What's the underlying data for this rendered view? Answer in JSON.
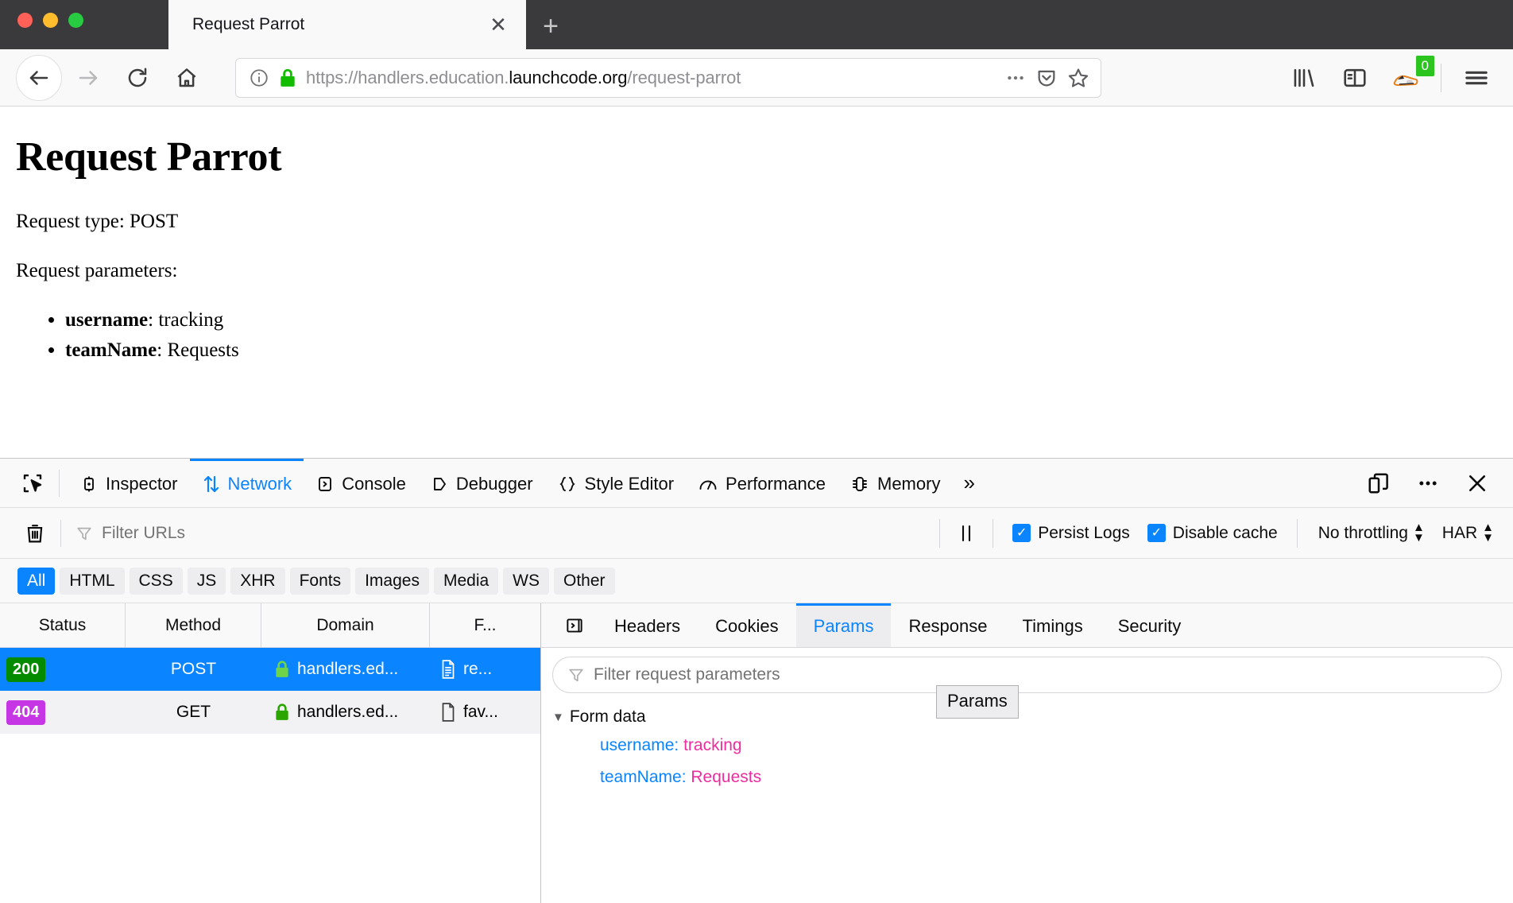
{
  "browser": {
    "tab": {
      "title": "Request Parrot",
      "close_label": "✕"
    },
    "new_tab_label": "+",
    "url": {
      "prefix": "https://handlers.education.",
      "host": "launchcode.org",
      "suffix": "/request-parrot"
    },
    "extension_badge": "0"
  },
  "page": {
    "heading": "Request Parrot",
    "request_type_line": "Request type: POST",
    "parameters_label": "Request parameters:",
    "parameters": [
      {
        "name": "username",
        "sep": ": ",
        "value": "tracking"
      },
      {
        "name": "teamName",
        "sep": ": ",
        "value": "Requests"
      }
    ]
  },
  "devtools": {
    "tabs": [
      {
        "label": "Inspector",
        "icon": "inspector-icon",
        "active": false
      },
      {
        "label": "Network",
        "icon": "network-icon",
        "active": true
      },
      {
        "label": "Console",
        "icon": "console-icon",
        "active": false
      },
      {
        "label": "Debugger",
        "icon": "debugger-icon",
        "active": false
      },
      {
        "label": "Style Editor",
        "icon": "style-editor-icon",
        "active": false
      },
      {
        "label": "Performance",
        "icon": "performance-icon",
        "active": false
      },
      {
        "label": "Memory",
        "icon": "memory-icon",
        "active": false
      }
    ],
    "overflow_label": "»",
    "network": {
      "filter_urls_placeholder": "Filter URLs",
      "persist_logs_label": "Persist Logs",
      "persist_logs_checked": true,
      "disable_cache_label": "Disable cache",
      "disable_cache_checked": true,
      "throttling_label": "No throttling",
      "har_label": "HAR",
      "checkmark": "✓",
      "pills": [
        {
          "label": "All",
          "active": true
        },
        {
          "label": "HTML",
          "active": false
        },
        {
          "label": "CSS",
          "active": false
        },
        {
          "label": "JS",
          "active": false
        },
        {
          "label": "XHR",
          "active": false
        },
        {
          "label": "Fonts",
          "active": false
        },
        {
          "label": "Images",
          "active": false
        },
        {
          "label": "Media",
          "active": false
        },
        {
          "label": "WS",
          "active": false
        },
        {
          "label": "Other",
          "active": false
        }
      ],
      "columns": [
        "Status",
        "Method",
        "Domain",
        "F..."
      ],
      "rows": [
        {
          "status": "200",
          "status_color": "#058b00",
          "method": "POST",
          "domain": "handlers.ed...",
          "file": "re...",
          "selected": true
        },
        {
          "status": "404",
          "status_color": "#c736e5",
          "method": "GET",
          "domain": "handlers.ed...",
          "file": "fav...",
          "selected": false
        }
      ]
    },
    "details": {
      "tabs": [
        {
          "label": "Headers",
          "active": false
        },
        {
          "label": "Cookies",
          "active": false
        },
        {
          "label": "Params",
          "active": true
        },
        {
          "label": "Response",
          "active": false
        },
        {
          "label": "Timings",
          "active": false
        },
        {
          "label": "Security",
          "active": false
        }
      ],
      "filter_placeholder": "Filter request parameters",
      "group_label": "Form data",
      "group_expanded_marker": "▼",
      "params": [
        {
          "key": "username:",
          "value": "tracking"
        },
        {
          "key": "teamName:",
          "value": "Requests"
        }
      ],
      "tooltip": "Params"
    }
  }
}
